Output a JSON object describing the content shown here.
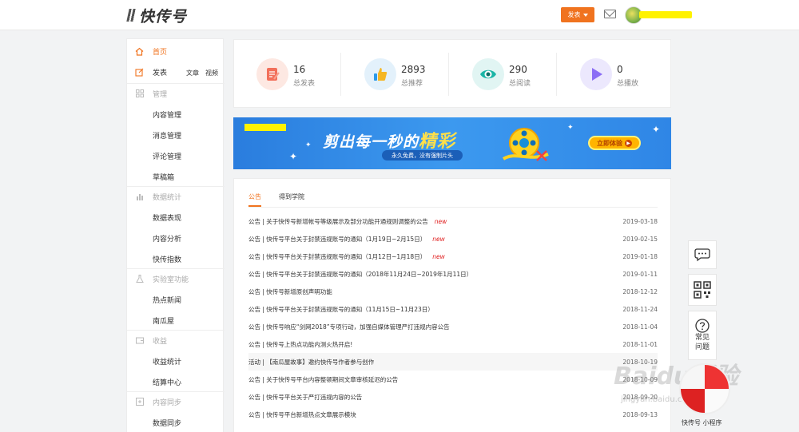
{
  "header": {
    "logo_text": "快传号",
    "publish_button": "发表"
  },
  "sidebar": {
    "home": "首页",
    "publish": "发表",
    "publish_article": "文章",
    "publish_video": "视频",
    "manage": "管理",
    "content_manage": "内容管理",
    "message_manage": "消息管理",
    "comment_manage": "评论管理",
    "drafts": "草稿箱",
    "data_stats": "数据统计",
    "data_show": "数据表现",
    "content_analysis": "内容分析",
    "kc_index": "快传指数",
    "lab": "实验室功能",
    "hot_news": "热点新闻",
    "pumpkin_house": "南瓜屋",
    "income": "收益",
    "income_stats": "收益统计",
    "settlement": "结算中心",
    "content_sync": "内容同步",
    "data_sync": "数据同步"
  },
  "stats": [
    {
      "value": "16",
      "label": "总发表",
      "icon": "edit-doc-icon",
      "color": "#f26f5a",
      "bg": "#fde8e2"
    },
    {
      "value": "2893",
      "label": "总推荐",
      "icon": "thumbs-up-icon",
      "color": "#f5a623",
      "bg": "#e3f1fb"
    },
    {
      "value": "290",
      "label": "总阅读",
      "icon": "eye-icon",
      "color": "#1ab5a6",
      "bg": "#e1f5f3"
    },
    {
      "value": "0",
      "label": "总播放",
      "icon": "play-icon",
      "color": "#8b6ef5",
      "bg": "#ece8fd"
    }
  ],
  "banner": {
    "title_a": "剪出每一秒的",
    "title_b": "精彩",
    "subtitle": "永久免费，没有强制片头",
    "cta": "立即体验"
  },
  "news": {
    "tab_announce": "公告",
    "tab_academy": "得到学院",
    "new_tag": "new",
    "items": [
      {
        "text": "公告 | 关于快传号新增帐号等级展示及部分功能开通规则调整的公告",
        "date": "2019-03-18",
        "is_new": true
      },
      {
        "text": "公告 | 快传号平台关于封禁违规账号的通知（1月19日~2月15日）",
        "date": "2019-02-15",
        "is_new": true
      },
      {
        "text": "公告 | 快传号平台关于封禁违规账号的通知（1月12日~1月18日）",
        "date": "2019-01-18",
        "is_new": true
      },
      {
        "text": "公告 | 快传号平台关于封禁违规账号的通知（2018年11月24日~2019年1月11日）",
        "date": "2019-01-11",
        "is_new": false
      },
      {
        "text": "公告 | 快传号新增原创声明功能",
        "date": "2018-12-12",
        "is_new": false
      },
      {
        "text": "公告 | 快传号平台关于封禁违规账号的通知（11月15日~11月23日）",
        "date": "2018-11-24",
        "is_new": false
      },
      {
        "text": "公告 | 快传号响应“剑网2018”专项行动，加强自媒体管理严打违规内容公告",
        "date": "2018-11-04",
        "is_new": false
      },
      {
        "text": "公告 | 快传号上热点功能内测火热开启!",
        "date": "2018-11-01",
        "is_new": false
      },
      {
        "text": "活动 | 【南瓜屋故事】邀约快传号作者参与创作",
        "date": "2018-10-19",
        "is_new": false
      },
      {
        "text": "公告 | 关于快传号平台内容整顿期间文章审核延迟的公告",
        "date": "2018-10-09",
        "is_new": false
      },
      {
        "text": "公告 | 快传号平台关于严打违规内容的公告",
        "date": "2018-09-20",
        "is_new": false
      },
      {
        "text": "公告 | 快传号平台新增热点文章展示模块",
        "date": "2018-09-13",
        "is_new": false
      }
    ]
  },
  "float": {
    "chat": "chat-bubble-icon",
    "qrcode": "qrcode-icon",
    "faq_a": "常见",
    "faq_b": "问题",
    "mini_program": "快传号 小程序"
  },
  "watermark": {
    "brand": "Baidu经验",
    "url": "jingyan.baidu.com"
  }
}
